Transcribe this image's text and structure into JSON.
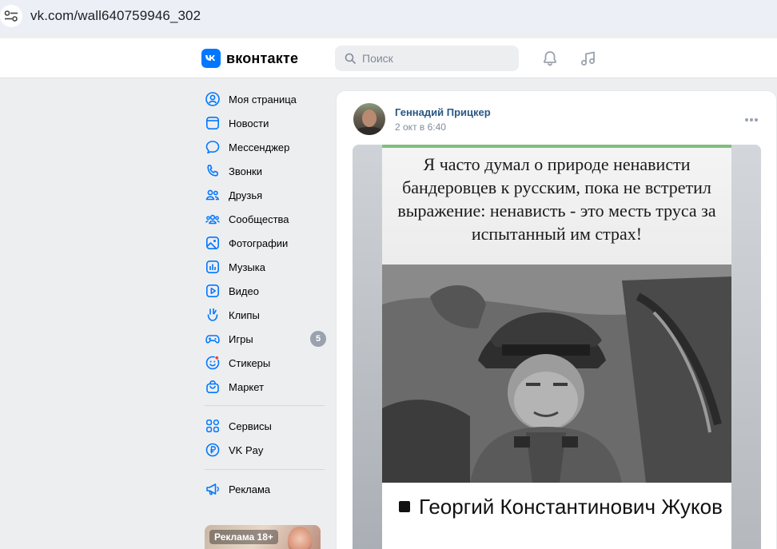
{
  "browser": {
    "url": "vk.com/wall640759946_302"
  },
  "header": {
    "logo_text": "вконтакте",
    "search": {
      "placeholder": "Поиск"
    },
    "icons": [
      "bell-icon",
      "music-icon"
    ]
  },
  "sidebar": {
    "items": [
      {
        "label": "Моя страница",
        "icon": "user-circle-icon"
      },
      {
        "label": "Новости",
        "icon": "newspaper-icon"
      },
      {
        "label": "Мессенджер",
        "icon": "message-icon"
      },
      {
        "label": "Звонки",
        "icon": "phone-icon"
      },
      {
        "label": "Друзья",
        "icon": "friends-icon"
      },
      {
        "label": "Сообщества",
        "icon": "communities-icon"
      },
      {
        "label": "Фотографии",
        "icon": "photo-icon"
      },
      {
        "label": "Музыка",
        "icon": "music-note-icon"
      },
      {
        "label": "Видео",
        "icon": "video-icon"
      },
      {
        "label": "Клипы",
        "icon": "clips-icon"
      },
      {
        "label": "Игры",
        "icon": "gamepad-icon",
        "badge": "5"
      },
      {
        "label": "Стикеры",
        "icon": "sticker-icon"
      },
      {
        "label": "Маркет",
        "icon": "bag-icon"
      }
    ],
    "items2": [
      {
        "label": "Сервисы",
        "icon": "services-icon"
      },
      {
        "label": "VK Pay",
        "icon": "vkpay-icon"
      }
    ],
    "items3": [
      {
        "label": "Реклама",
        "icon": "megaphone-icon"
      }
    ],
    "ad": {
      "label": "Реклама 18+"
    }
  },
  "post": {
    "author": "Геннадий Прицкер",
    "date": "2 окт в 6:40",
    "image_text": "Я часто думал о природе ненависти бандеровцев к русским, пока не встретил выражение: ненависть - это месть труса за испытанный им страх!",
    "caption": "Георгий Константинович Жуков"
  },
  "colors": {
    "accent": "#0077ff",
    "link": "#2a5885",
    "background": "#edeef0",
    "icon": "#0077ff"
  }
}
